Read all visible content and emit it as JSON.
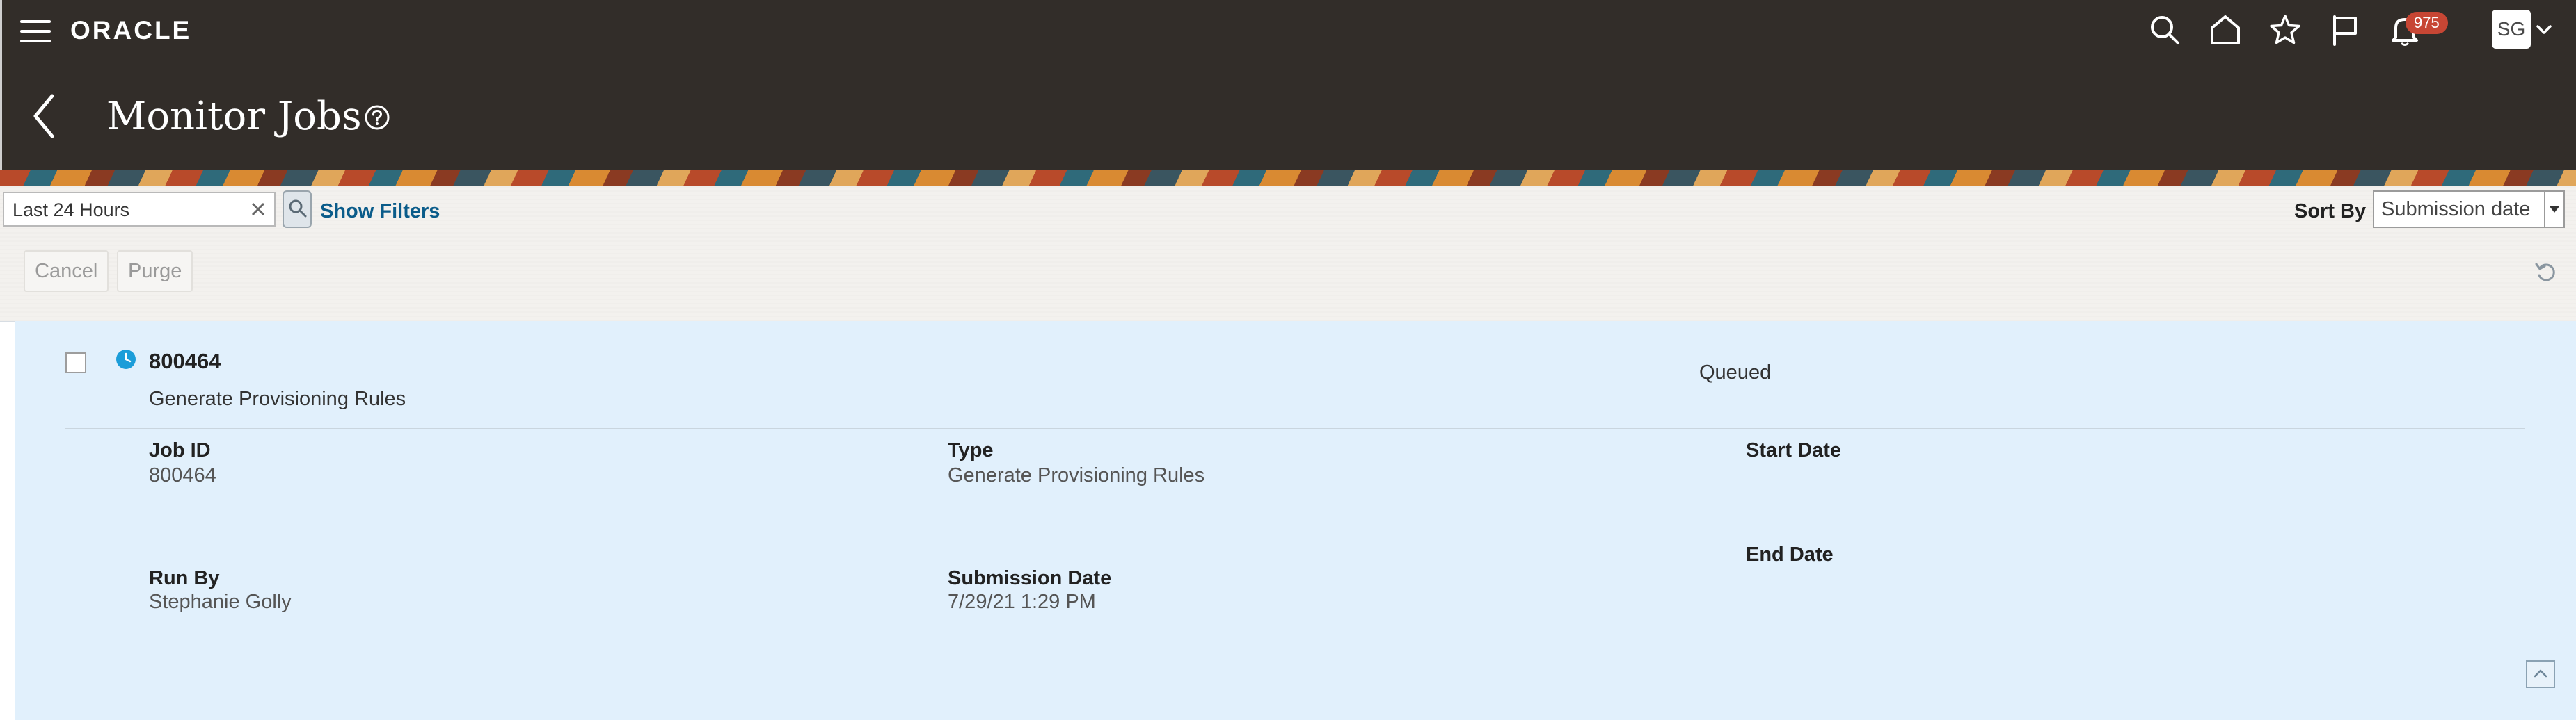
{
  "header": {
    "logo": "ORACLE",
    "notification_count": "975",
    "user_initials": "SG",
    "page_title": "Monitor Jobs"
  },
  "filters": {
    "search_value": "Last 24 Hours",
    "show_filters_label": "Show Filters",
    "sort_by_label": "Sort By",
    "sort_by_value": "Submission date"
  },
  "toolbar": {
    "cancel_label": "Cancel",
    "purge_label": "Purge"
  },
  "job": {
    "number": "800464",
    "name": "Generate Provisioning Rules",
    "status": "Queued",
    "fields": {
      "job_id_label": "Job ID",
      "job_id_value": "800464",
      "type_label": "Type",
      "type_value": "Generate Provisioning Rules",
      "start_date_label": "Start Date",
      "end_date_label": "End Date",
      "run_by_label": "Run By",
      "run_by_value": "Stephanie Golly",
      "submission_date_label": "Submission Date",
      "submission_date_value": "7/29/21 1:29 PM"
    }
  },
  "colors": {
    "header_bg": "#322d29",
    "card_bg": "#e1f0fc",
    "link": "#0b5c8a",
    "badge": "#c74634",
    "status_icon": "#1b9dd9"
  },
  "icons": {
    "menu": "hamburger-icon",
    "search": "search-icon",
    "home": "home-icon",
    "favorites": "star-icon",
    "flag": "flag-icon",
    "notifications": "bell-icon",
    "back": "back-arrow-icon",
    "help": "help-icon",
    "refresh": "refresh-icon",
    "collapse": "collapse-icon"
  }
}
